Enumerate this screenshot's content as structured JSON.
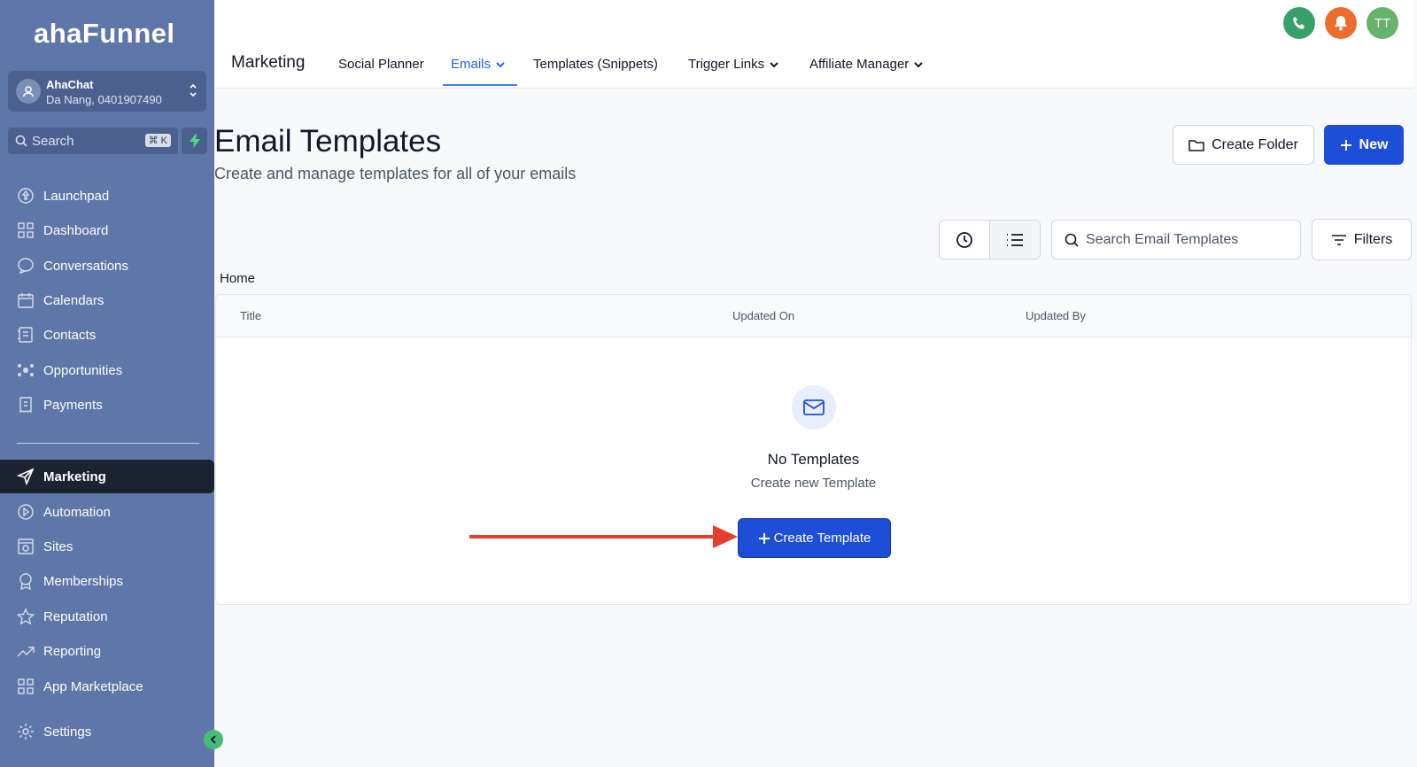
{
  "brand": {
    "logo": "ahaFunnel"
  },
  "account": {
    "name": "AhaChat",
    "detail": "Da Nang, 0401907490"
  },
  "search": {
    "placeholder": "Search",
    "shortcut": "⌘ K"
  },
  "sidebar": {
    "items": [
      {
        "label": "Launchpad",
        "icon": "rocket-icon"
      },
      {
        "label": "Dashboard",
        "icon": "grid-icon"
      },
      {
        "label": "Conversations",
        "icon": "chat-icon"
      },
      {
        "label": "Calendars",
        "icon": "calendar-icon"
      },
      {
        "label": "Contacts",
        "icon": "contacts-icon"
      },
      {
        "label": "Opportunities",
        "icon": "network-icon"
      },
      {
        "label": "Payments",
        "icon": "receipt-icon"
      },
      {
        "label": "Marketing",
        "icon": "send-icon",
        "active": true
      },
      {
        "label": "Automation",
        "icon": "automation-icon"
      },
      {
        "label": "Sites",
        "icon": "sites-icon"
      },
      {
        "label": "Memberships",
        "icon": "badge-icon"
      },
      {
        "label": "Reputation",
        "icon": "star-icon"
      },
      {
        "label": "Reporting",
        "icon": "trend-icon"
      },
      {
        "label": "App Marketplace",
        "icon": "apps-icon"
      },
      {
        "label": "Settings",
        "icon": "gear-icon"
      }
    ]
  },
  "header": {
    "title": "Marketing",
    "tabs": [
      {
        "label": "Social Planner"
      },
      {
        "label": "Emails",
        "active": true
      },
      {
        "label": "Templates (Snippets)"
      },
      {
        "label": "Trigger Links"
      },
      {
        "label": "Affiliate Manager"
      }
    ],
    "avatar_initials": "TT",
    "colors": {
      "phone": "#38a169",
      "bell": "#ed6c2e",
      "avatar": "#68b36b"
    }
  },
  "main": {
    "title": "Email Templates",
    "subtitle": "Create and manage templates for all of your emails",
    "create_folder_label": "Create Folder",
    "new_label": "New",
    "search_placeholder": "Search Email Templates",
    "filters_label": "Filters",
    "breadcrumb": "Home",
    "columns": [
      "Title",
      "Updated On",
      "Updated By"
    ],
    "empty_title": "No Templates",
    "empty_subtitle": "Create new Template",
    "create_template_label": "Create Template"
  },
  "colors": {
    "sidebar": "#5f77a8",
    "primary": "#1d4ed8",
    "annotation_arrow": "#e53e2e"
  }
}
